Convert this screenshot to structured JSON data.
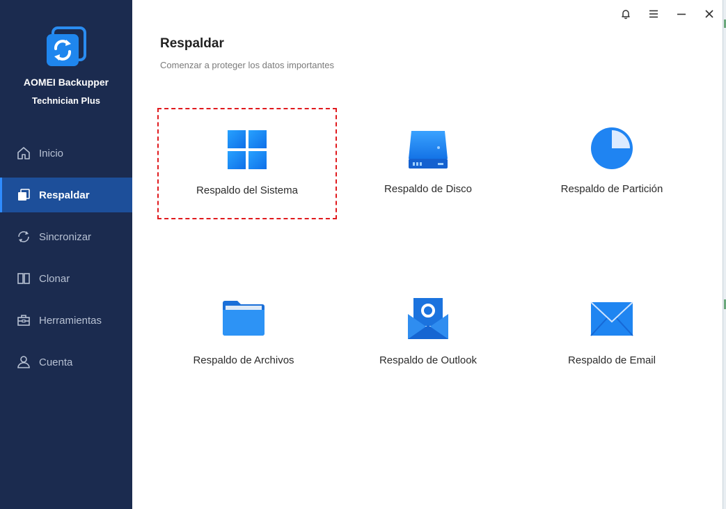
{
  "app": {
    "name": "AOMEI Backupper",
    "edition": "Technician Plus",
    "logo_icon": "sync-arrows-icon"
  },
  "titlebar": {
    "buttons": [
      {
        "name": "notification-bell-icon"
      },
      {
        "name": "menu-icon"
      },
      {
        "name": "minimize-icon"
      },
      {
        "name": "close-icon"
      }
    ]
  },
  "sidebar": {
    "items": [
      {
        "label": "Inicio",
        "icon": "home-icon",
        "active": false
      },
      {
        "label": "Respaldar",
        "icon": "backup-icon",
        "active": true
      },
      {
        "label": "Sincronizar",
        "icon": "sync-icon",
        "active": false
      },
      {
        "label": "Clonar",
        "icon": "clone-icon",
        "active": false
      },
      {
        "label": "Herramientas",
        "icon": "toolbox-icon",
        "active": false
      },
      {
        "label": "Cuenta",
        "icon": "user-icon",
        "active": false
      }
    ]
  },
  "main": {
    "title": "Respaldar",
    "subtitle": "Comenzar a proteger los datos importantes",
    "tiles": [
      {
        "label": "Respaldo del Sistema",
        "icon": "windows-icon",
        "selected": true
      },
      {
        "label": "Respaldo de Disco",
        "icon": "disk-icon",
        "selected": false
      },
      {
        "label": "Respaldo de Partición",
        "icon": "partition-pie-icon",
        "selected": false
      },
      {
        "label": "Respaldo de Archivos",
        "icon": "folder-icon",
        "selected": false
      },
      {
        "label": "Respaldo de Outlook",
        "icon": "outlook-icon",
        "selected": false
      },
      {
        "label": "Respaldo de Email",
        "icon": "email-icon",
        "selected": false
      }
    ]
  },
  "colors": {
    "sidebar_bg": "#1b2b4f",
    "sidebar_active": "#1d4f9a",
    "accent_blue": "#1f7ff0",
    "selection_border": "#e0191d"
  }
}
